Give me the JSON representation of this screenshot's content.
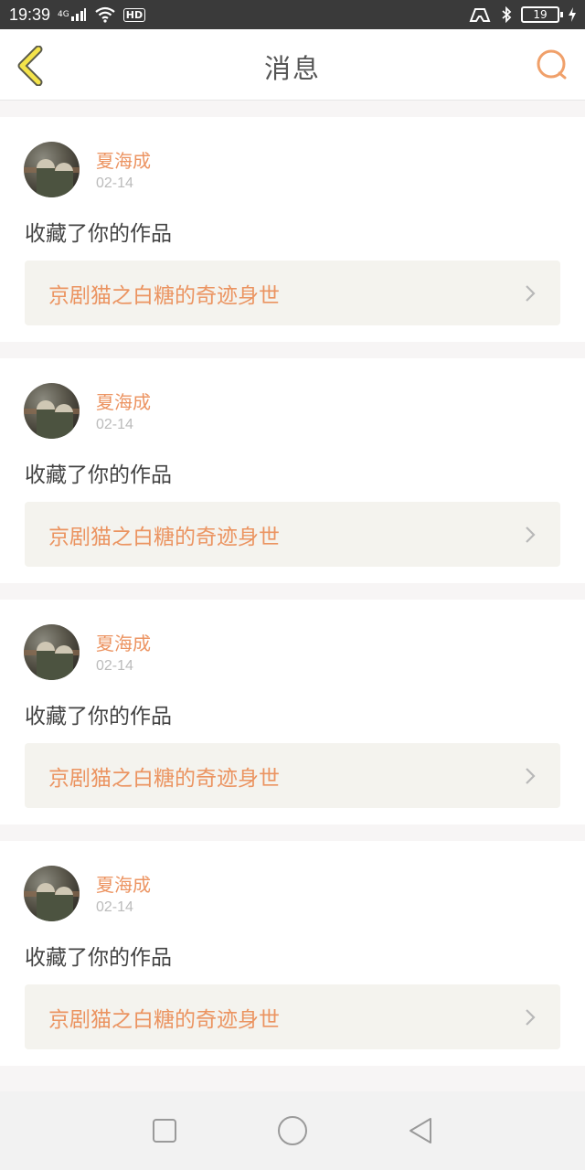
{
  "status_bar": {
    "time": "19:39",
    "network": "4G",
    "hd": "HD",
    "battery": "19"
  },
  "header": {
    "title": "消息",
    "back_icon": "chevron-left-icon",
    "search_icon": "search-icon",
    "accent_color": "#ec9462"
  },
  "messages": [
    {
      "username": "夏海成",
      "date": "02-14",
      "action": "收藏了你的作品",
      "work_title": "京剧猫之白糖的奇迹身世"
    },
    {
      "username": "夏海成",
      "date": "02-14",
      "action": "收藏了你的作品",
      "work_title": "京剧猫之白糖的奇迹身世"
    },
    {
      "username": "夏海成",
      "date": "02-14",
      "action": "收藏了你的作品",
      "work_title": "京剧猫之白糖的奇迹身世"
    },
    {
      "username": "夏海成",
      "date": "02-14",
      "action": "收藏了你的作品",
      "work_title": "京剧猫之白糖的奇迹身世"
    }
  ],
  "nav_bar": {
    "recents_icon": "square-icon",
    "home_icon": "circle-icon",
    "back_icon": "triangle-back-icon"
  }
}
